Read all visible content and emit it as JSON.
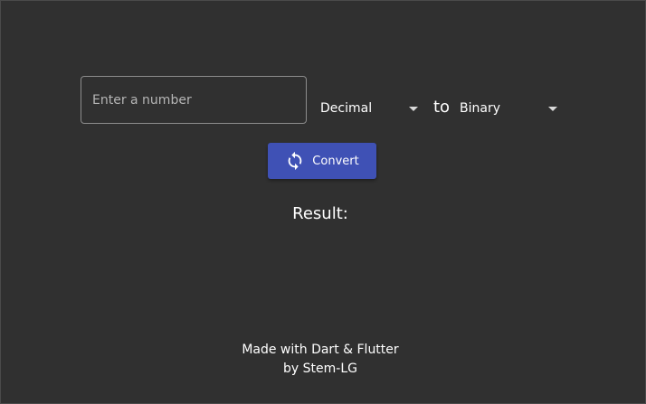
{
  "input": {
    "placeholder": "Enter a number",
    "value": ""
  },
  "from_dropdown": {
    "selected": "Decimal",
    "icon": "caret-down-icon"
  },
  "to_text": "to",
  "to_dropdown": {
    "selected": "Binary",
    "icon": "caret-down-icon"
  },
  "convert_button": {
    "label": "Convert",
    "icon": "sync-icon",
    "color": "#3f51b5"
  },
  "result": {
    "label": "Result:"
  },
  "footer": {
    "line1": "Made with Dart & Flutter",
    "line2": "by Stem-LG"
  },
  "colors": {
    "background": "#303030",
    "accent": "#3f51b5"
  }
}
